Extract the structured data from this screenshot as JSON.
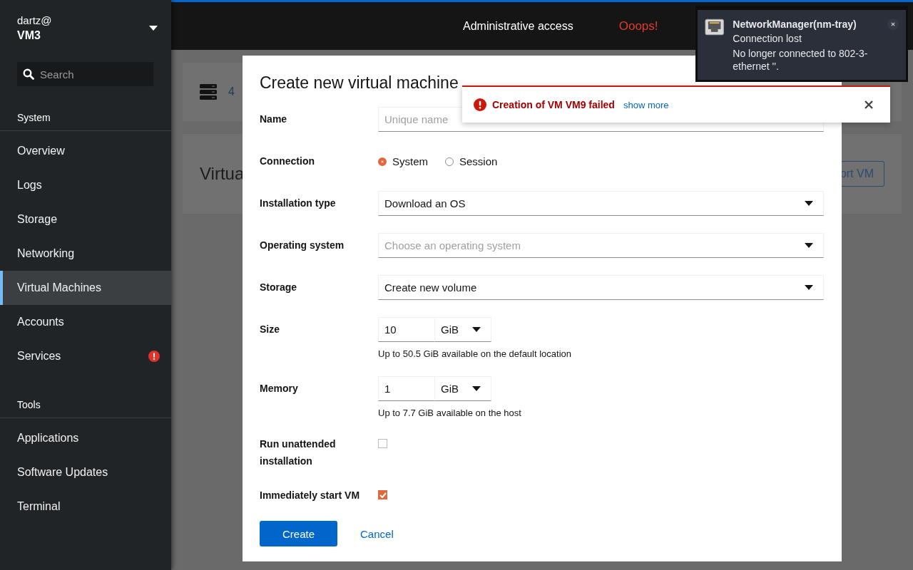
{
  "sidebar": {
    "user": "dartz@",
    "host": "VM3",
    "search": {
      "placeholder": "Search"
    },
    "sections": [
      {
        "title": "System",
        "items": [
          {
            "label": "Overview",
            "selected": false,
            "alert": false
          },
          {
            "label": "Logs",
            "selected": false,
            "alert": false
          },
          {
            "label": "Storage",
            "selected": false,
            "alert": false
          },
          {
            "label": "Networking",
            "selected": false,
            "alert": false
          },
          {
            "label": "Virtual Machines",
            "selected": true,
            "alert": false
          },
          {
            "label": "Accounts",
            "selected": false,
            "alert": false
          },
          {
            "label": "Services",
            "selected": false,
            "alert": true
          }
        ]
      },
      {
        "title": "Tools",
        "items": [
          {
            "label": "Applications",
            "selected": false,
            "alert": false
          },
          {
            "label": "Software Updates",
            "selected": false,
            "alert": false
          },
          {
            "label": "Terminal",
            "selected": false,
            "alert": false
          }
        ]
      }
    ]
  },
  "topbar": {
    "access": "Administrative access",
    "error": "Ooops!"
  },
  "background": {
    "summary": "4",
    "heading": "Virtua",
    "button": "ort VM"
  },
  "dialog": {
    "title": "Create new virtual machine",
    "fields": [
      {
        "kind": "text",
        "label": "Name",
        "placeholder": "Unique name"
      },
      {
        "kind": "radio",
        "label": "Connection",
        "options": [
          {
            "label": "System",
            "selected": true
          },
          {
            "label": "Session",
            "selected": false
          }
        ]
      },
      {
        "kind": "select",
        "label": "Installation type",
        "value": "Download an OS"
      },
      {
        "kind": "select",
        "label": "Operating system",
        "placeholder": "Choose an operating system"
      },
      {
        "kind": "select",
        "label": "Storage",
        "value": "Create new volume"
      },
      {
        "kind": "size",
        "label": "Size",
        "value": "10",
        "unit": "GiB",
        "help": "Up to 50.5 GiB available on the default location"
      },
      {
        "kind": "size",
        "label": "Memory",
        "value": "1",
        "unit": "GiB",
        "help": "Up to 7.7 GiB available on the host"
      },
      {
        "kind": "checkbox",
        "label": "Run unattended installation",
        "checked": false
      },
      {
        "kind": "checkbox",
        "label": "Immediately start VM",
        "checked": true
      }
    ],
    "primary": "Create",
    "cancel": "Cancel"
  },
  "alert": {
    "title": "Creation of VM VM9 failed",
    "link": "show more"
  },
  "notification": {
    "app": "NetworkManager(nm-tray)",
    "summary": "Connection lost",
    "body": "No longer connected to 802-3-ethernet ''."
  }
}
